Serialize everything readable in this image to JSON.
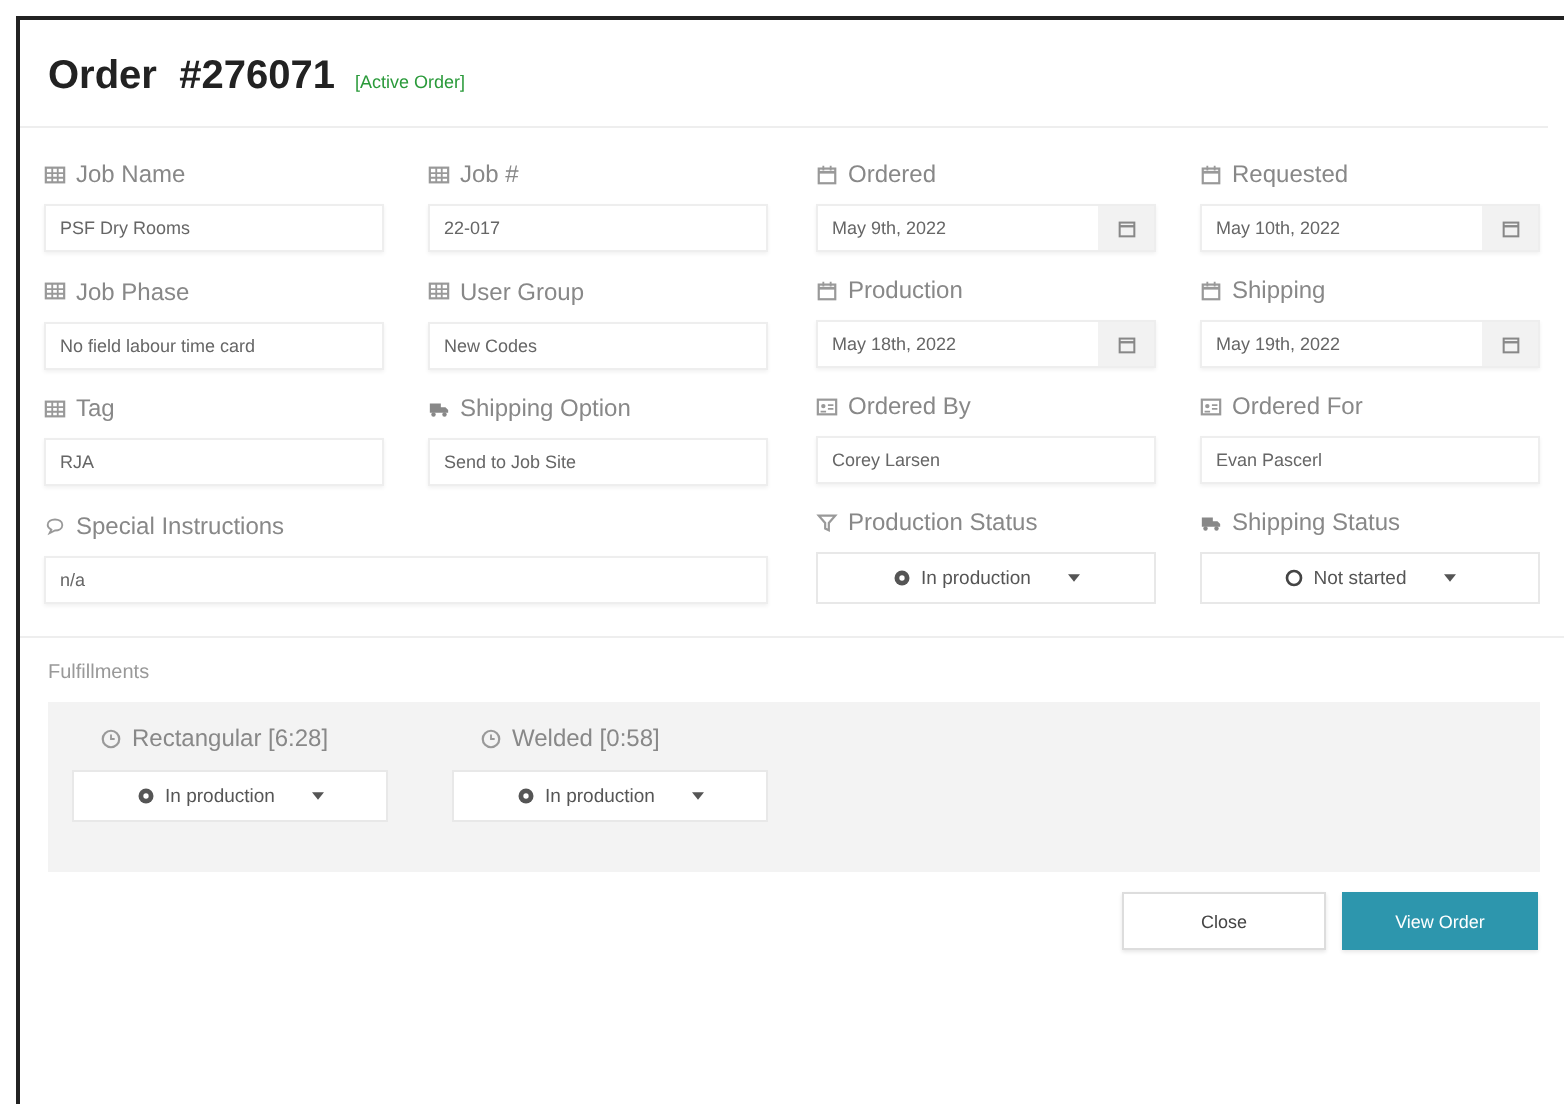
{
  "header": {
    "title": "Order",
    "order_number": "#276071",
    "badge": "[Active Order]"
  },
  "left_fields": [
    {
      "label": "Job Name",
      "kind": "text",
      "value": "PSF Dry Rooms"
    },
    {
      "label": "Job #",
      "kind": "text",
      "value": "22-017"
    },
    {
      "label": "Job Phase",
      "kind": "text",
      "value": "No field labour time card"
    },
    {
      "label": "User Group",
      "kind": "text",
      "value": "New Codes"
    },
    {
      "label": "Tag",
      "kind": "text",
      "value": "RJA"
    },
    {
      "label": "Shipping Option",
      "kind": "text",
      "value": "Send to Job Site"
    },
    {
      "label": "Special Instructions",
      "kind": "wide",
      "value": "n/a"
    }
  ],
  "right_fields": [
    {
      "label": "Ordered",
      "kind": "date",
      "value": "May 9th, 2022"
    },
    {
      "label": "Requested",
      "kind": "date",
      "value": "May 10th, 2022"
    },
    {
      "label": "Production",
      "kind": "date",
      "value": "May 18th, 2022"
    },
    {
      "label": "Shipping",
      "kind": "date",
      "value": "May 19th, 2022"
    },
    {
      "label": "Ordered By",
      "kind": "text",
      "value": "Corey Larsen"
    },
    {
      "label": "Ordered For",
      "kind": "text",
      "value": "Evan Pascerl"
    },
    {
      "label": "Production Status",
      "kind": "select",
      "value": "In production"
    },
    {
      "label": "Shipping Status",
      "kind": "select",
      "value": "Not started"
    }
  ],
  "fulfillments": {
    "title": "Fulfillments",
    "items": [
      {
        "label": "Rectangular [6:28]",
        "value": "In production"
      },
      {
        "label": "Welded [0:58]",
        "value": "In production"
      }
    ]
  },
  "buttons": [
    {
      "label": "Close",
      "kind": "secondary"
    },
    {
      "label": "View Order",
      "kind": "primary"
    }
  ]
}
